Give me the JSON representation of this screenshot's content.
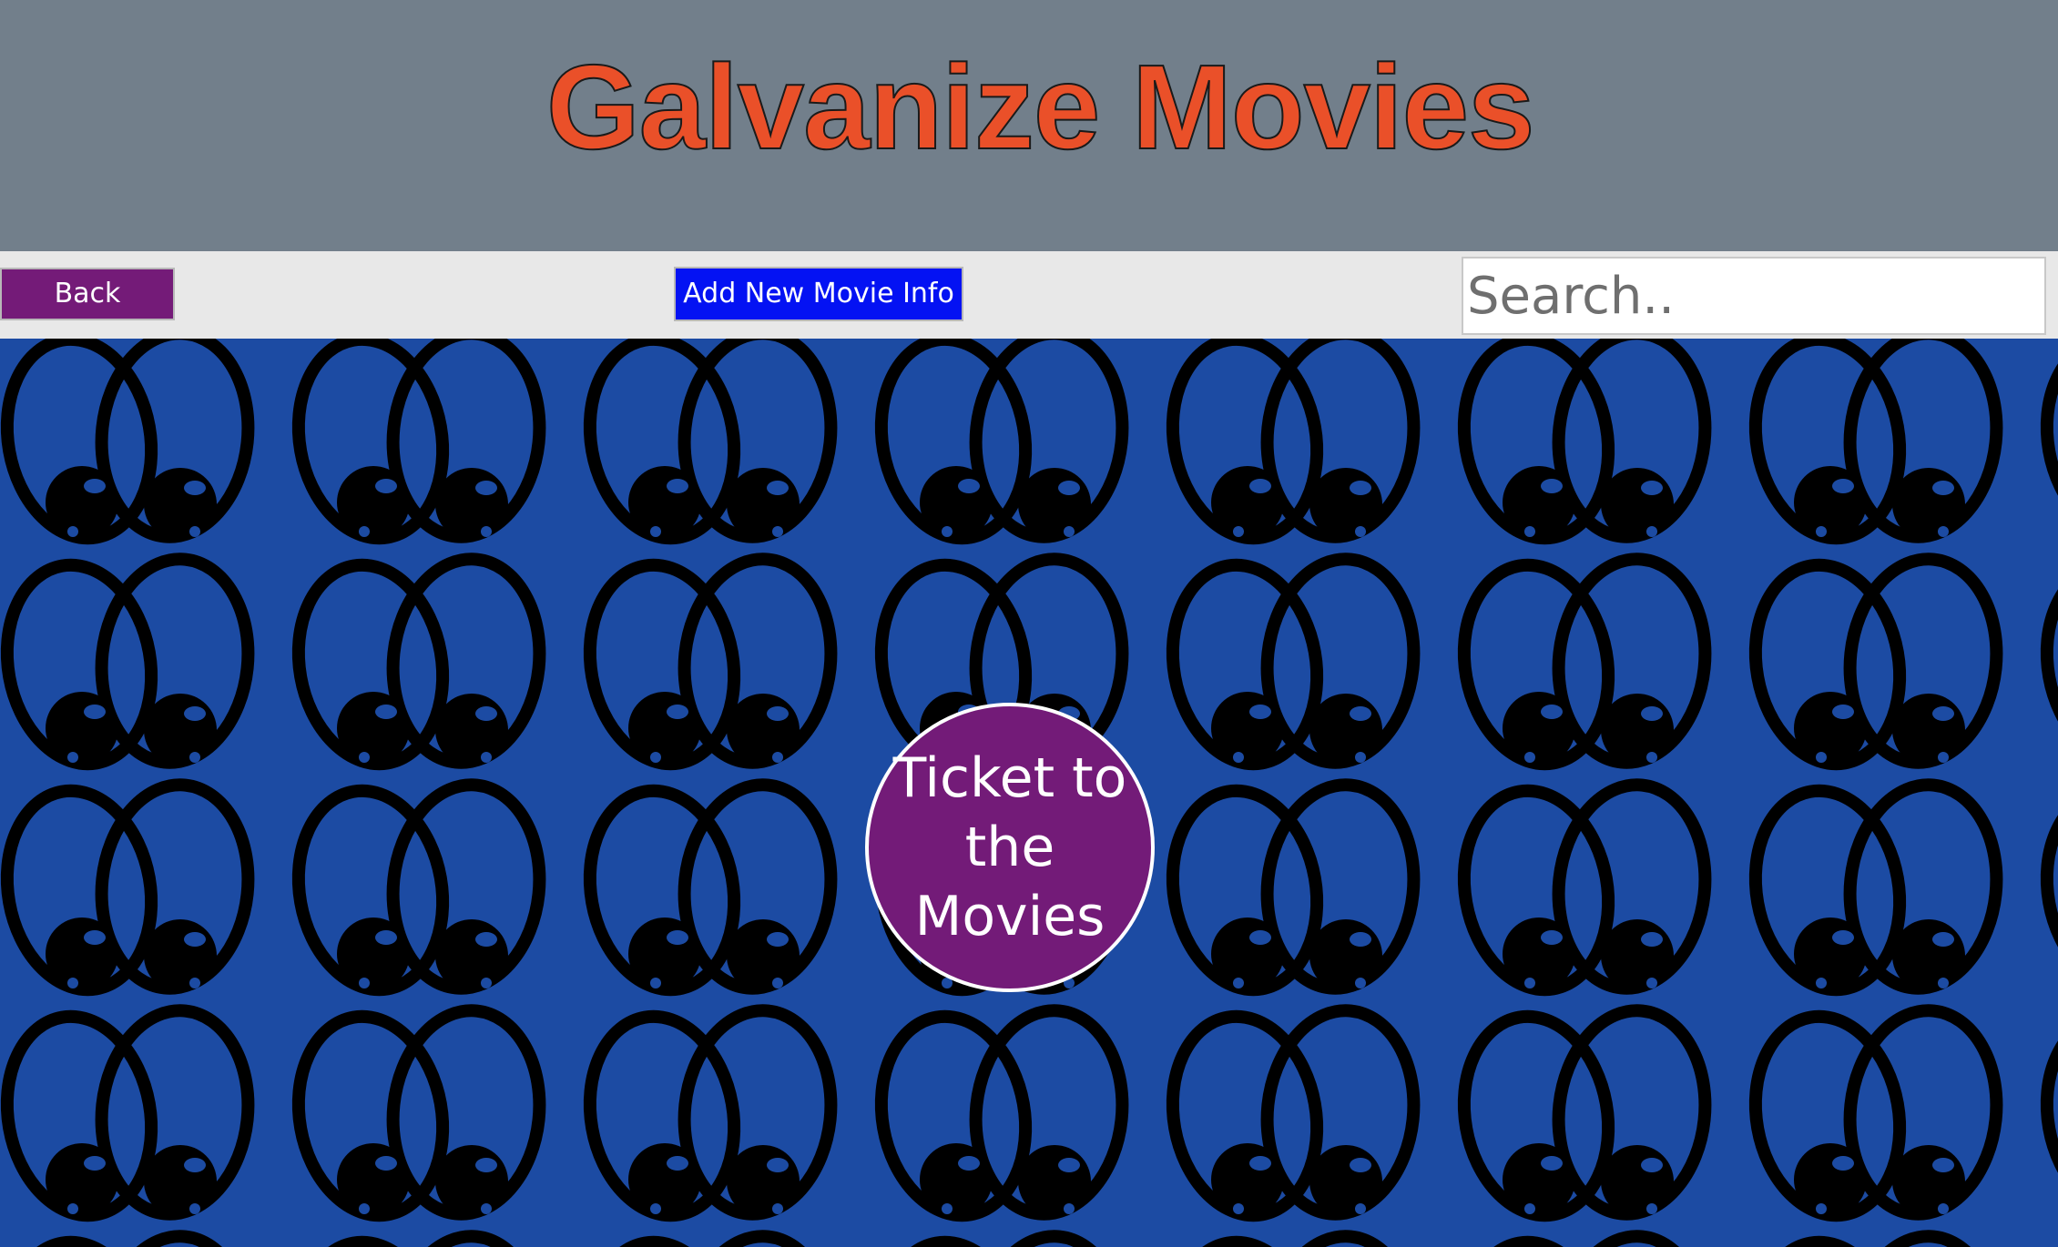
{
  "header": {
    "title": "Galvanize Movies"
  },
  "toolbar": {
    "back_label": "Back",
    "add_label": "Add New Movie Info",
    "search_placeholder": "Search.."
  },
  "main": {
    "background_pattern_icon": "cartoon-eyes-icon",
    "ticket_label": "Ticket to the Movies"
  },
  "colors": {
    "header_bg": "#727f8b",
    "title": "#ea5029",
    "toolbar_bg": "#e8e8e8",
    "back_button": "#741b78",
    "add_button": "#0412f3",
    "main_bg": "#1c4ba3",
    "ticket_circle": "#731b78"
  }
}
